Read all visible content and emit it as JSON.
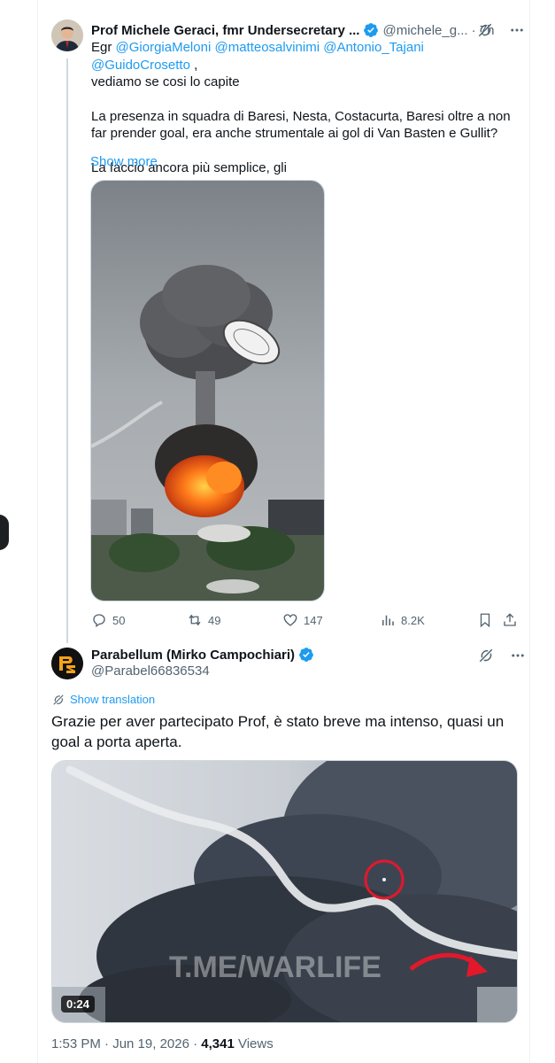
{
  "tweet1": {
    "author_name": "Prof Michele Geraci, fmr Undersecretary ...",
    "handle": "@michele_g...",
    "time": "· 7h",
    "text_prefix": "Egr ",
    "mentions": [
      "@GiorgiaMeloni",
      "@matteosalvinimi",
      "@Antonio_Tajani",
      "@GuidoCrosetto"
    ],
    "text_suffix": " ,",
    "line2": "vediamo se cosi lo capite",
    "paragraph2": "La presenza in squadra di Baresi, Nesta, Costacurta, Baresi oltre a non far prender goal, era anche strumentale ai gol di Van Basten e Gullit?",
    "paragraph3": "La faccio ancora più semplice, gli",
    "show_more": "Show more",
    "stats": {
      "replies": "50",
      "reposts": "49",
      "likes": "147",
      "views": "8.2K"
    }
  },
  "tweet2": {
    "author_name": "Parabellum (Mirko Campochiari)",
    "handle": "@Parabel66836534",
    "show_translation": "Show translation",
    "text": "Grazie per aver partecipato Prof, è stato breve ma intenso, quasi un goal a porta aperta.",
    "video_watermark": "T.ME/WARLIFE",
    "video_duration": "0:24",
    "timestamp": "1:53 PM · Jun 19, 2026 · ",
    "views_count": "4,341",
    "views_label": " Views"
  },
  "colors": {
    "accent": "#1d9bf0",
    "text_primary": "#0f1419",
    "text_secondary": "#536471",
    "border": "#cfd9de"
  }
}
